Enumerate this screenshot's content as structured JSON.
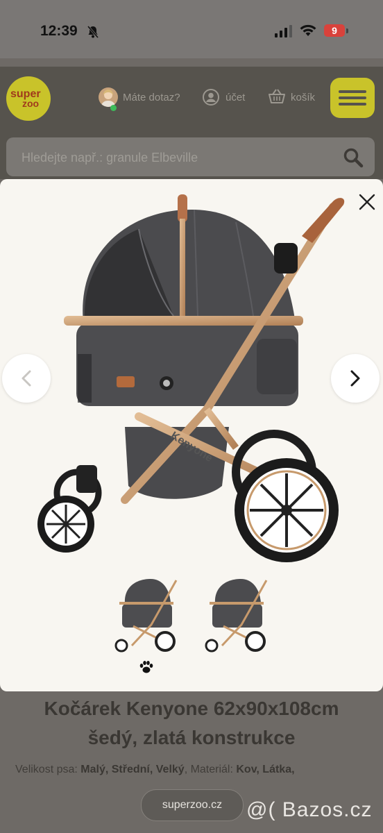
{
  "status_bar": {
    "time": "12:39",
    "battery": "9"
  },
  "header": {
    "logo_line1": "super",
    "logo_line2": "zoo",
    "help_label": "Máte dotaz?",
    "account_label": "účet",
    "cart_label": "košík"
  },
  "search": {
    "placeholder": "Hledejte např.: granule Elbeville"
  },
  "gallery": {
    "thumbnail_count": 2
  },
  "product": {
    "title_line1": "Kočárek Kenyone 62x90x108cm",
    "title_line2": "šedý, zlatá konstrukce",
    "specs_prefix": "Velikost psa: ",
    "specs_sizes": "Malý, Střední, Velký",
    "specs_mid": ", Materiál: ",
    "specs_material": "Kov, Látka,",
    "brand_on_frame": "Kenyone"
  },
  "browser": {
    "url": "superzoo.cz"
  },
  "watermark": "@( Bazos.cz",
  "colors": {
    "brand_yellow": "#c9c32a",
    "frame_gold": "#c79a6c",
    "fabric_gray": "#4a4a4d"
  }
}
